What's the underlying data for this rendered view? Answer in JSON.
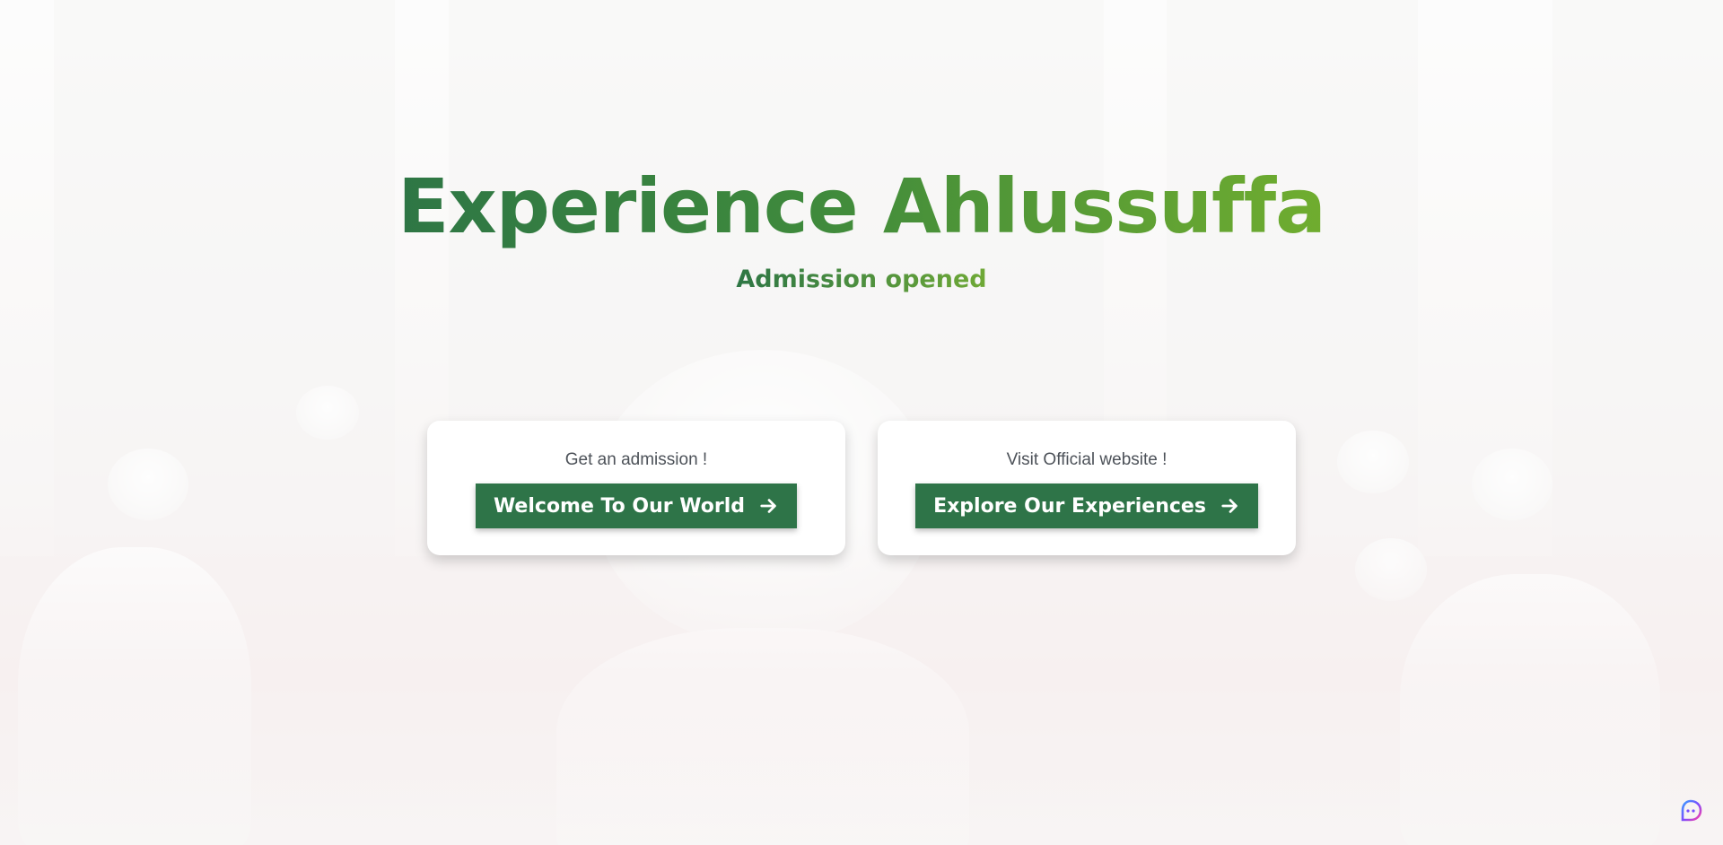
{
  "hero": {
    "title": "Experience Ahlussuffa",
    "subtitle": "Admission opened"
  },
  "cards": [
    {
      "label": "Get an admission !",
      "button_label": "Welcome To Our World",
      "button_icon": "arrow-right-icon"
    },
    {
      "label": "Visit Official website !",
      "button_label": "Explore Our Experiences",
      "button_icon": "arrow-right-icon"
    }
  ],
  "assistant": {
    "icon": "assistant-chat-icon"
  },
  "colors": {
    "button_background": "#2e7448",
    "title_gradient_start": "#2e7645",
    "title_gradient_end": "#70ad2f",
    "card_background": "#ffffff"
  }
}
